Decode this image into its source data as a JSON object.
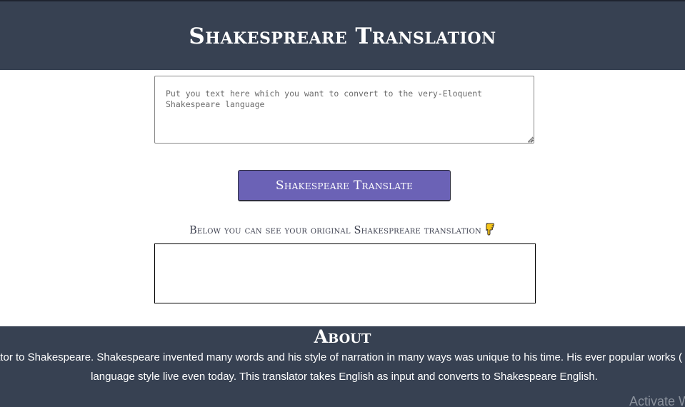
{
  "header": {
    "title": "Shakespreare Translation"
  },
  "translator": {
    "input_placeholder": "Put you text here which you want to convert to the very-Eloquent Shakespeare language",
    "input_value": "",
    "translate_button_label": "Shakespeare Translate",
    "output_heading": "Below you can see your original Shakespreare translation",
    "output_icon": "pointing-down-hand-icon",
    "output_text": ""
  },
  "about": {
    "title": "About",
    "line1": "Translator to Shakespeare. Shakespeare invented many words and his style of narration in many ways was unique to his time. His ever popular works ( dramas",
    "line2": "language style live even today. This translator takes English as input and converts to Shakespeare English."
  },
  "os_watermark": {
    "text": "Activate Windows"
  },
  "colors": {
    "header_bg": "#374152",
    "button_bg": "#6b62b6",
    "icon_yellow": "#f5c518"
  }
}
